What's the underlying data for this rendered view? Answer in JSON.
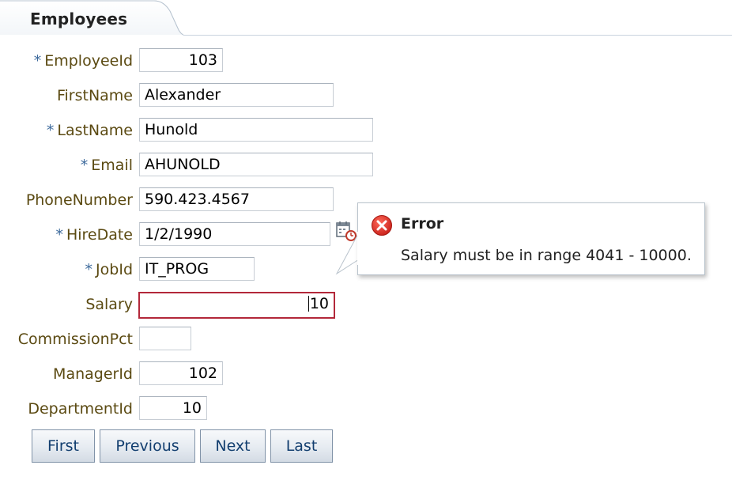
{
  "tab": {
    "title": "Employees"
  },
  "fields": {
    "employee_id": {
      "label": "EmployeeId",
      "required": "*",
      "value": "103"
    },
    "first_name": {
      "label": "FirstName",
      "value": "Alexander"
    },
    "last_name": {
      "label": "LastName",
      "required": "*",
      "value": "Hunold"
    },
    "email": {
      "label": "Email",
      "required": "*",
      "value": "AHUNOLD"
    },
    "phone_number": {
      "label": "PhoneNumber",
      "value": "590.423.4567"
    },
    "hire_date": {
      "label": "HireDate",
      "required": "*",
      "value": "1/2/1990"
    },
    "job_id": {
      "label": "JobId",
      "required": "*",
      "value": "IT_PROG"
    },
    "salary": {
      "label": "Salary",
      "value": "10"
    },
    "commission_pct": {
      "label": "CommissionPct",
      "value": ""
    },
    "manager_id": {
      "label": "ManagerId",
      "value": "102"
    },
    "department_id": {
      "label": "DepartmentId",
      "value": "10"
    }
  },
  "error_popup": {
    "title": "Error",
    "message": "Salary must be in range 4041 - 10000.",
    "icon": "error-x-icon"
  },
  "icons": {
    "hire_date_picker": "calendar-icon"
  },
  "buttons": {
    "first": "First",
    "previous": "Previous",
    "next": "Next",
    "last": "Last"
  },
  "colors": {
    "label": "#5b4a12",
    "required": "#3d6a9c",
    "error_border": "#b3283a",
    "button_text": "#123e6f"
  }
}
